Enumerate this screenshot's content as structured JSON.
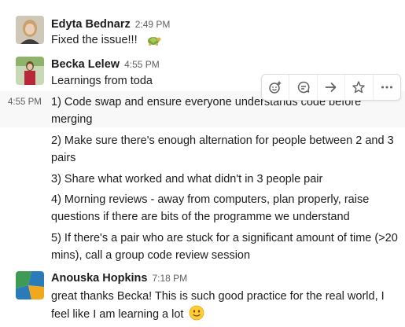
{
  "messages": [
    {
      "author": "Edyta Bednarz",
      "time": "2:49 PM",
      "text": "Fixed the issue!!!",
      "emoji": "turtle-emoji"
    },
    {
      "author": "Becka Lelew",
      "time": "4:55 PM",
      "text": "Learnings from toda",
      "continuations": [
        {
          "hover_time": "4:55 PM",
          "text": "1) Code swap and ensure everyone understands code before merging"
        },
        {
          "text": "2) Make sure there's enough alternation  for people between 2 and 3 pairs"
        },
        {
          "text": "3) Share what worked and what didn't in 3 people pair"
        },
        {
          "text": "4) Morning reviews - away from computers, plan properly, raise questions if there are bits of the programme we understand"
        },
        {
          "text": "5) If there's a pair who are stuck for a significant amount of time (>20 mins), call a group code review session"
        }
      ]
    },
    {
      "author": "Anouska Hopkins",
      "time": "7:18 PM",
      "text": "great thanks Becka! This is such good practice for the real world, I feel like I am learning a lot",
      "emoji": "slightly-smiling-face-emoji"
    }
  ],
  "hover_toolbar": {
    "icons": [
      "add-reaction-icon",
      "reply-in-thread-icon",
      "share-message-icon",
      "save-star-icon",
      "more-actions-icon"
    ]
  },
  "colors": {
    "text": "#1d1c1d",
    "timestamp": "#616061",
    "hover_background": "#f8f8f8"
  }
}
